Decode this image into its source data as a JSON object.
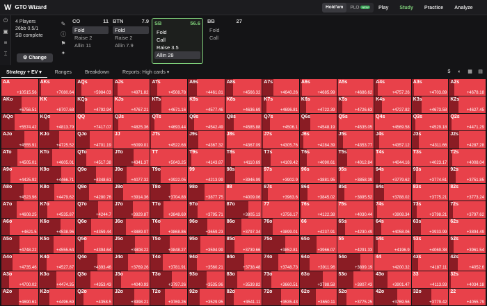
{
  "app": {
    "logo": "W",
    "title": "GTO Wizard"
  },
  "game_tabs": [
    {
      "label": "Hold'em",
      "active": true
    },
    {
      "label": "PLO",
      "active": false,
      "badge": "NEW"
    }
  ],
  "nav": [
    {
      "label": "Play"
    },
    {
      "label": "Study",
      "active": true
    },
    {
      "label": "Practice"
    },
    {
      "label": "Analyze"
    }
  ],
  "info": {
    "players": "4 Players",
    "stack": "26bb 0.5/1",
    "status": "SB complete",
    "change": "Change"
  },
  "players": [
    {
      "pos": "CO",
      "val": "11",
      "actions": [
        {
          "label": "Fold",
          "sel": true
        },
        {
          "label": "Raise 2"
        },
        {
          "label": "Allin 11"
        }
      ]
    },
    {
      "pos": "BTN",
      "val": "7.9",
      "actions": [
        {
          "label": "Fold",
          "sel": true
        },
        {
          "label": "Raise 2"
        },
        {
          "label": "Allin 7.9"
        }
      ]
    },
    {
      "pos": "SB",
      "val": "56.6",
      "active": true,
      "actions": [
        {
          "label": "Fold"
        },
        {
          "label": "Call"
        },
        {
          "label": "Raise 3.5"
        },
        {
          "label": "Allin 28",
          "sel": true
        }
      ]
    },
    {
      "pos": "BB",
      "val": "27",
      "actions": [
        {
          "label": "Fold"
        },
        {
          "label": "Call"
        }
      ]
    }
  ],
  "subtabs": [
    {
      "label": "Strategy + EV",
      "active": true
    },
    {
      "label": "Ranges"
    },
    {
      "label": "Breakdown"
    },
    {
      "label": "Reports: High cards"
    }
  ],
  "colors": {
    "allin": "#e8414a",
    "fold": "#8a1c24",
    "accent": "#7fd07a"
  },
  "grid": [
    [
      "AA",
      "+10515.56",
      "AKs",
      "+7080.64",
      "AQs",
      "+5984.03",
      "AJs",
      "+4971.82",
      "ATs",
      "+4508.78",
      "A9s",
      "+4461.81",
      "A8s",
      "+4566.32",
      "A7s",
      "+4640.26",
      "A6s",
      "+4685.99",
      "A5s",
      "+4686.62",
      "A4s",
      "+4757.26",
      "A3s",
      "+4703.89",
      "A2s",
      "+4678.18"
    ],
    [
      "AKo",
      "+6756.51",
      "KK",
      "+8707.68",
      "KQs",
      "+4792.94",
      "KJs",
      "+4767.21",
      "KTs",
      "+4671.16",
      "K9s",
      "+4577.46",
      "K8s",
      "+4636.69",
      "K7s",
      "+4696.81",
      "K6s",
      "+4722.39",
      "K5s",
      "+4726.63",
      "K4s",
      "+4727.82",
      "K3s",
      "+4673.58",
      "K2s",
      "+4627.45"
    ],
    [
      "AQo",
      "+5574.42",
      "KQo",
      "+4813.79",
      "QQ",
      "+7417.07",
      "QJs",
      "+4825.36",
      "QTs",
      "+4693.44",
      "Q9s",
      "+4542.49",
      "Q8s",
      "+4585.88",
      "Q7s",
      "+4506.1",
      "Q6s",
      "+4548.19",
      "Q5s",
      "+4535.05",
      "Q4s",
      "+4569.58",
      "Q3s",
      "+4529.18",
      "Q2s",
      "+4471.29"
    ],
    [
      "AJo",
      "+4555.91",
      "KJo",
      "+4725.52",
      "QJo",
      "+4701.19",
      "JJ",
      "+6099.01",
      "JTs",
      "+4522.68",
      "J9s",
      "+4367.32",
      "J8s",
      "+4367.09",
      "J7s",
      "+4305.76",
      "J6s",
      "+4284.39",
      "J5s",
      "+4353.77",
      "J4s",
      "+4357.12",
      "J3s",
      "+4311.66",
      "J2s",
      "+4287.28"
    ],
    [
      "ATo",
      "+4505.01",
      "KTo",
      "+4605.01",
      "QTo",
      "+4517.38",
      "JTo",
      "+4341.37",
      "TT",
      "+5043.25",
      "T9s",
      "+4143.87",
      "T8s",
      "+4110.69",
      "T7s",
      "+4109.42",
      "T6s",
      "+4090.61",
      "T5s",
      "+4012.84",
      "T4s",
      "+4044.16",
      "T3s",
      "+4023.17",
      "T2s",
      "+4008.04"
    ],
    [
      "A9o",
      "+4425.92",
      "K9o",
      "+4466.71",
      "Q9o",
      "+4348.61",
      "J9o",
      "+4077.32",
      "T9o",
      "+3922.05",
      "99",
      "+4213.99",
      "98s",
      "+3946.99",
      "97s",
      "+3902.9",
      "96s",
      "+3881.95",
      "95s",
      "+3858.39",
      "94s",
      "+3779.62",
      "93s",
      "+3774.61",
      "92s",
      "+3751.85"
    ],
    [
      "A8o",
      "+4523.96",
      "K8o",
      "+4479.62",
      "Q8o",
      "+4280.76",
      "J8o",
      "+3914.36",
      "T8o",
      "+3704.88",
      "98o",
      "+3877.75",
      "88",
      "+4009.06",
      "87s",
      "+3963.6",
      "86s",
      "+3845.02",
      "85s",
      "+3895.52",
      "84s",
      "+3788.02",
      "83s",
      "+3775.21",
      "82s",
      "+3773.24"
    ],
    [
      "A7o",
      "+4608.25",
      "K7o",
      "+4535.87",
      "Q7o",
      "+4244.7",
      "J7o",
      "+3929.87",
      "T7o",
      "+3848.69",
      "97o",
      "+3795.71",
      "87o",
      "+3805.13",
      "77",
      "+3756.17",
      "76s",
      "+4122.38",
      "75s",
      "+4030.44",
      "74s",
      "+3908.34",
      "73s",
      "+3798.21",
      "72s",
      "+3797.62"
    ],
    [
      "A6o",
      "+4621.5",
      "K6o",
      "+4538.96",
      "Q6o",
      "+4359.44",
      "J6o",
      "+3889.07",
      "T6o",
      "+3868.86",
      "96o",
      "+3659.23",
      "86o",
      "+3797.34",
      "76o",
      "+3899.01",
      "66",
      "+4237.91",
      "65s",
      "+4230.49",
      "64s",
      "+4058.06",
      "63s",
      "+3933.99",
      "62s",
      "+3894.49"
    ],
    [
      "A5o",
      "+4748.22",
      "K5o",
      "+4555.64",
      "Q5o",
      "+4394.64",
      "J5o",
      "+3808.22",
      "T5o",
      "+3848.27",
      "95o",
      "+3594.99",
      "85o",
      "+3739.66",
      "75o",
      "+3852.81",
      "65o",
      "+3966.07",
      "55",
      "+4291.33",
      "54s",
      "+4196.9",
      "53s",
      "+4069.38",
      "52s",
      "+3961.54"
    ],
    [
      "A4o",
      "+4735.46",
      "K4o",
      "+4527.87",
      "Q4o",
      "+4393.46",
      "J4o",
      "+3769.26",
      "T4o",
      "+3781.91",
      "94o",
      "+3560.21",
      "84o",
      "+3738.48",
      "74o",
      "+3748.73",
      "64o",
      "+3911.96",
      "54o",
      "+3899.19",
      "44",
      "+4200.32",
      "43s",
      "+4187.11",
      "42s",
      "+4052.6"
    ],
    [
      "A3o",
      "+4700.02",
      "K3o",
      "+4474.35",
      "Q3o",
      "+4353.43",
      "J3o",
      "+4040.93",
      "T3o",
      "+3797.26",
      "93o",
      "+3535.96",
      "83o",
      "+3539.82",
      "73o",
      "+3660.51",
      "63o",
      "+3788.58",
      "53o",
      "+3807.43",
      "43o",
      "+3901.47",
      "33",
      "+4113.93",
      "32s",
      "+4034.18"
    ],
    [
      "A2o",
      "+4690.61",
      "K2o",
      "+4496.69",
      "Q2o",
      "+4358.5",
      "J2o",
      "+3998.21",
      "T2o",
      "+3769.26",
      "92o",
      "+3529.95",
      "82o",
      "+3541.11",
      "72o",
      "+3535.43",
      "62o",
      "+3650.11",
      "52o",
      "+3775.25",
      "42o",
      "+3769.56",
      "32o",
      "+3779.42",
      "22",
      "+4055.79"
    ]
  ]
}
